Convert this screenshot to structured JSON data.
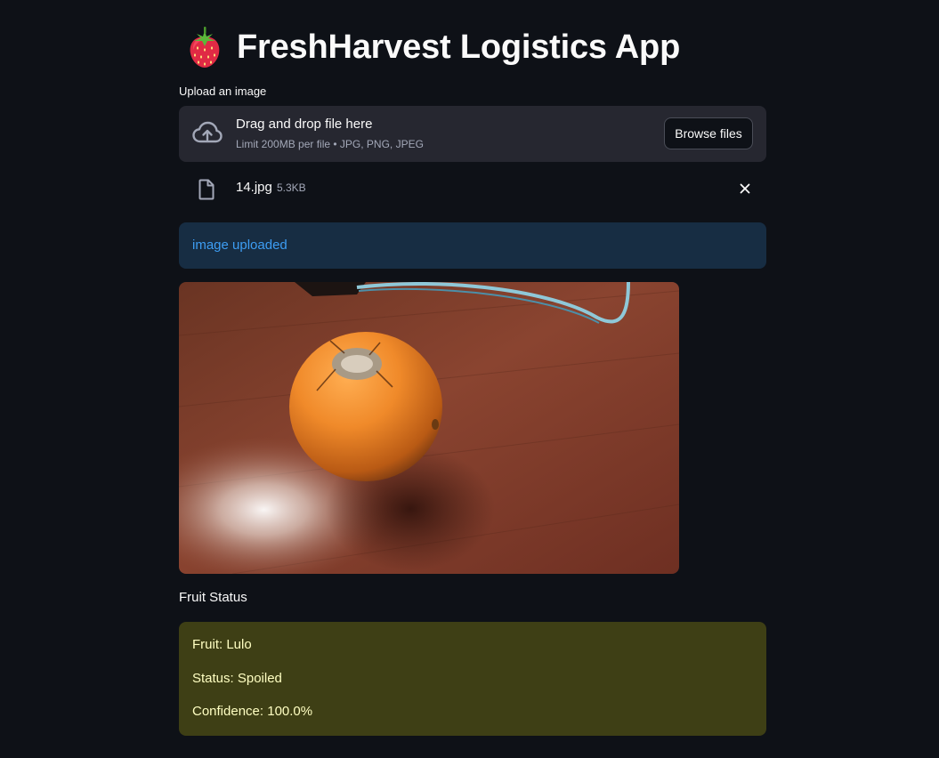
{
  "app": {
    "title": "FreshHarvest Logistics App",
    "title_icon": "strawberry-icon"
  },
  "uploader": {
    "label": "Upload an image",
    "dropzone_title": "Drag and drop file here",
    "dropzone_subtitle": "Limit 200MB per file • JPG, PNG, JPEG",
    "browse_label": "Browse files",
    "upload_icon": "cloud-upload-icon",
    "file": {
      "name": "14.jpg",
      "size": "5.3KB",
      "icon": "file-icon",
      "remove_icon": "close-icon"
    }
  },
  "info": {
    "message": "image uploaded"
  },
  "result": {
    "heading": "Fruit Status",
    "lines": [
      "Fruit: Lulo",
      "Status: Spoiled",
      "Confidence: 100.0%"
    ]
  },
  "colors": {
    "background": "#0e1117",
    "dropzone": "#262730",
    "info_bg": "#172d43",
    "info_text": "#3d9df3",
    "warning_bg": "#3e3f15",
    "warning_text": "#ffffc2"
  }
}
